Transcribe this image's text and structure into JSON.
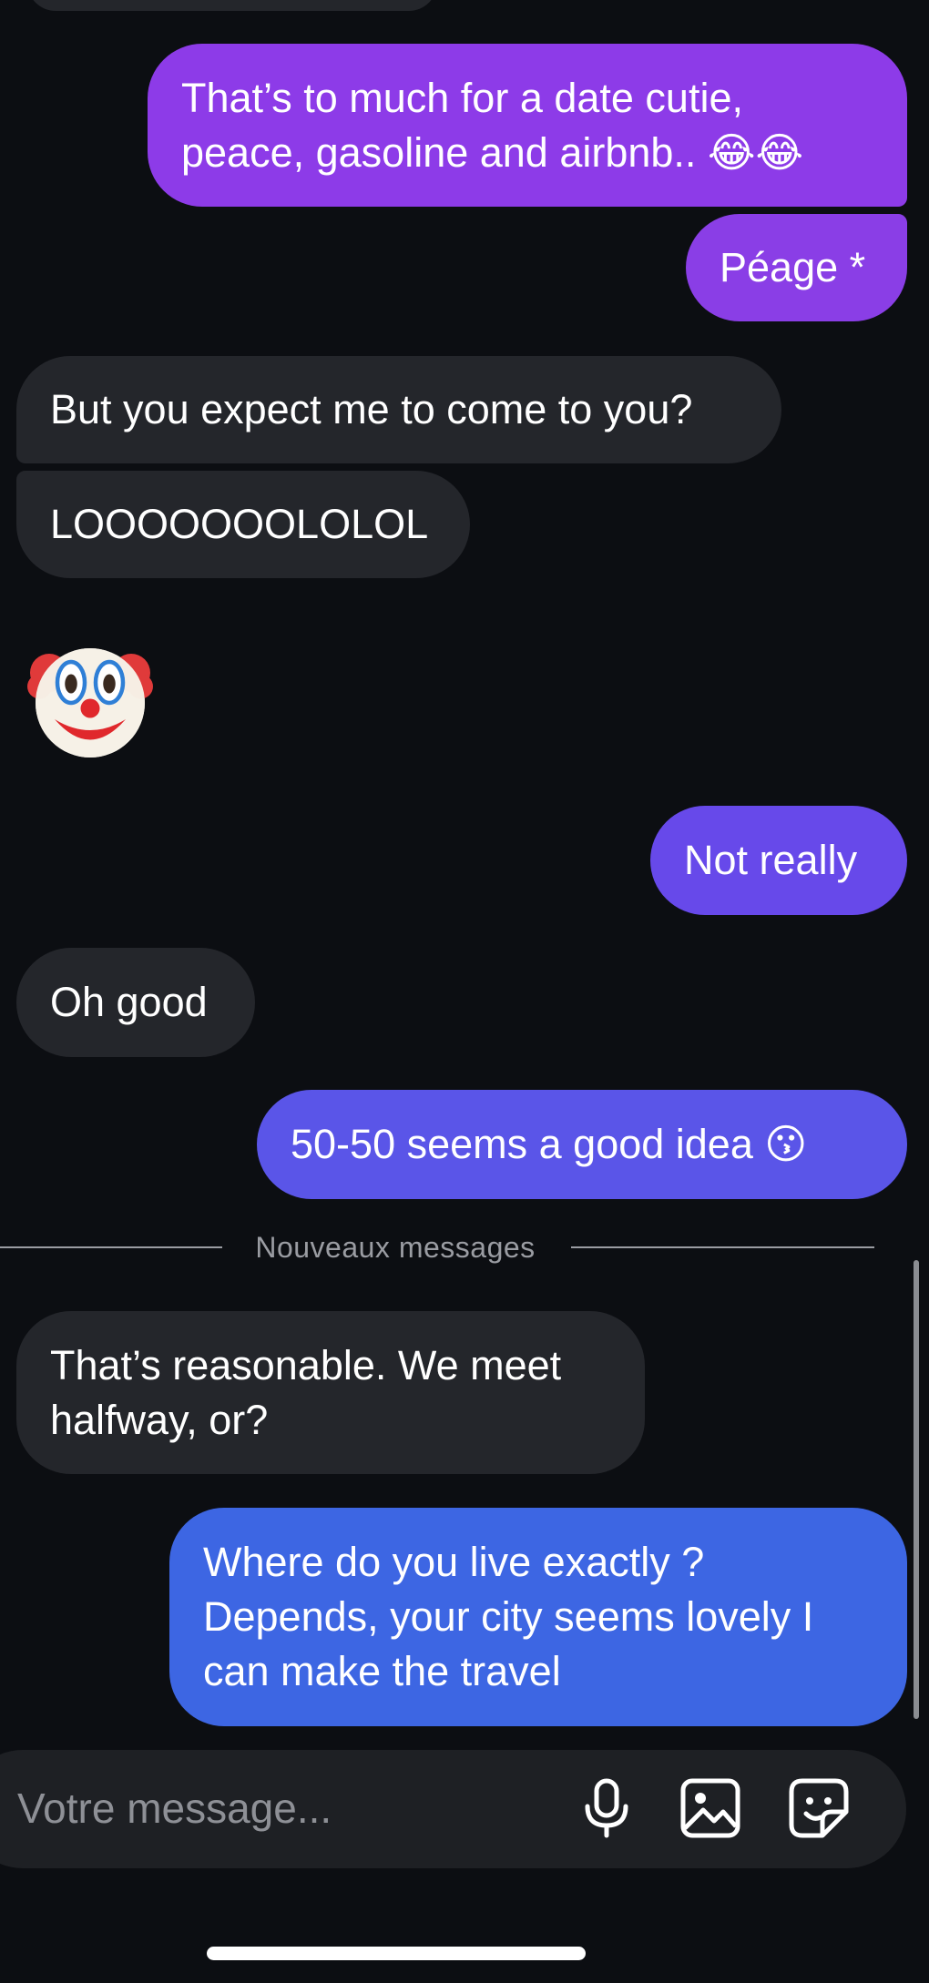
{
  "conversation": {
    "messages": [
      {
        "direction": "outgoing",
        "text": "That’s to much for a date cutie,\npeace, gasoline and airbnb.. 😂😂",
        "color": "#8d3be8"
      },
      {
        "direction": "outgoing",
        "text": "Péage *",
        "color": "#8a3ee6"
      },
      {
        "direction": "incoming",
        "text": "But you expect me to come to you?"
      },
      {
        "direction": "incoming",
        "text": "LOOOOOOOLOLOL"
      },
      {
        "direction": "incoming",
        "text": "🤡",
        "icon": "clown-face-emoji"
      },
      {
        "direction": "outgoing",
        "text": "Not really",
        "color": "#6749ea"
      },
      {
        "direction": "incoming",
        "text": "Oh good"
      },
      {
        "direction": "outgoing",
        "text": "50-50 seems a good idea 😗",
        "color": "#5a55e8"
      },
      {
        "direction": "incoming",
        "text": "That’s reasonable. We meet\nhalfway, or?"
      },
      {
        "direction": "outgoing",
        "text": "Where do you live exactly ?\nDepends, your city seems lovely I\ncan make the travel",
        "color": "#3d66e3"
      }
    ],
    "new_messages_divider": "Nouveaux messages"
  },
  "composer": {
    "placeholder": "Votre message...",
    "icons": [
      "microphone-icon",
      "image-icon",
      "sticker-icon"
    ]
  },
  "colors": {
    "background": "#0c0e12",
    "incoming_bubble": "#24262b",
    "outgoing_purple": "#8d3be8",
    "outgoing_indigo": "#6749ea",
    "outgoing_blue": "#3d66e3",
    "muted_text": "#9a9ca2"
  }
}
